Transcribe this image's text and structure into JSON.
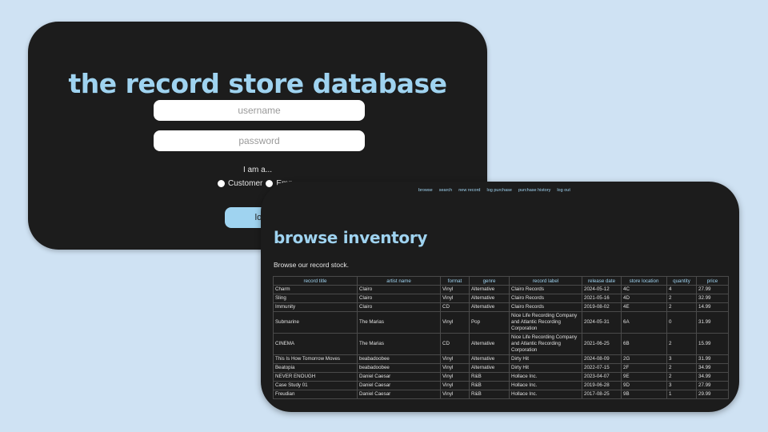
{
  "login": {
    "title": "the record store database",
    "username_placeholder": "username",
    "password_placeholder": "password",
    "role_prompt": "I am a...",
    "roles": [
      "Customer",
      "Emp"
    ],
    "login_button": "log"
  },
  "nav": {
    "items": [
      "browse",
      "search",
      "new record",
      "log purchase",
      "purchase history",
      "log out"
    ]
  },
  "inventory": {
    "title": "browse inventory",
    "subtitle": "Browse our record stock.",
    "columns": [
      "record title",
      "artist name",
      "format",
      "genre",
      "record label",
      "release date",
      "store location",
      "quantity",
      "price"
    ],
    "rows": [
      [
        "Charm",
        "Clairo",
        "Vinyl",
        "Alternative",
        "Clairo Records",
        "2024-05-12",
        "4C",
        "4",
        "27.99"
      ],
      [
        "Sling",
        "Clairo",
        "Vinyl",
        "Alternative",
        "Clairo Records",
        "2021-05-16",
        "4D",
        "2",
        "32.99"
      ],
      [
        "Immunity",
        "Clairo",
        "CD",
        "Alternative",
        "Clairo Records",
        "2019-08-02",
        "4E",
        "2",
        "14.99"
      ],
      [
        "Submarine",
        "The Marias",
        "Vinyl",
        "Pop",
        "Nice Life Recording Company and Atlantic Recording Corporation",
        "2024-05-31",
        "6A",
        "0",
        "31.99"
      ],
      [
        "CINEMA",
        "The Marias",
        "CD",
        "Alternative",
        "Nice Life Recording Company and Atlantic Recording Corporation",
        "2021-06-25",
        "6B",
        "2",
        "15.99"
      ],
      [
        "This Is How Tomorrow Moves",
        "beabadoobee",
        "Vinyl",
        "Alternative",
        "Dirty Hit",
        "2024-08-09",
        "2G",
        "3",
        "31.99"
      ],
      [
        "Beatopia",
        "beabadoobee",
        "Vinyl",
        "Alternative",
        "Dirty Hit",
        "2022-07-15",
        "2F",
        "2",
        "34.99"
      ],
      [
        "NEVER ENOUGH",
        "Daniel Caesar",
        "Vinyl",
        "R&B",
        "Hollace Inc.",
        "2023-04-07",
        "9E",
        "2",
        "34.99"
      ],
      [
        "Case Study 01",
        "Daniel Caesar",
        "Vinyl",
        "R&B",
        "Hollace Inc.",
        "2019-06-28",
        "9D",
        "3",
        "27.99"
      ],
      [
        "Freudian",
        "Daniel Caesar",
        "Vinyl",
        "R&B",
        "Hollace Inc.",
        "2017-08-25",
        "9B",
        "1",
        "29.99"
      ]
    ]
  },
  "colors": {
    "background": "#cfe2f3",
    "card": "#1c1c1c",
    "accent": "#9fd3f0"
  }
}
